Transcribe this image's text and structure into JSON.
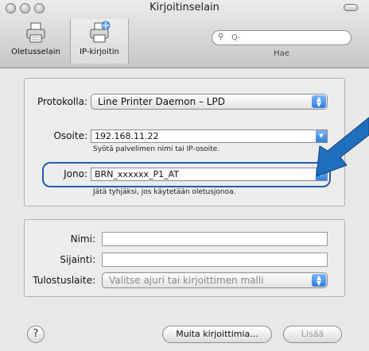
{
  "window": {
    "title": "Kirjoitinselain"
  },
  "toolbar": {
    "default_browser_label": "Oletusselain",
    "ip_printer_label": "IP-kirjoitin",
    "search_placeholder": "Q-",
    "search_label": "Hae"
  },
  "form": {
    "protocol_label": "Protokolla:",
    "protocol_value": "Line Printer Daemon – LPD",
    "address_label": "Osoite:",
    "address_value": "192.168.11.22",
    "address_hint": "Syötä palvelimen nimi tai IP-osoite.",
    "queue_label": "Jono:",
    "queue_value": "BRN_xxxxxx_P1_AT",
    "queue_hint": "Jätä tyhjäksi, jos käytetään oletusjonoa."
  },
  "details": {
    "name_label": "Nimi:",
    "name_value": "",
    "location_label": "Sijainti:",
    "location_value": "",
    "print_using_label": "Tulostuslaite:",
    "print_using_value": "Valitse ajuri tai kirjoittimen malli"
  },
  "footer": {
    "help_label": "?",
    "more_printers_label": "Muita kirjoittimia...",
    "add_label": "Lisää"
  },
  "icons": {
    "callout_arrow": "arrow-icon",
    "callout_color": "#1f6fbe"
  }
}
